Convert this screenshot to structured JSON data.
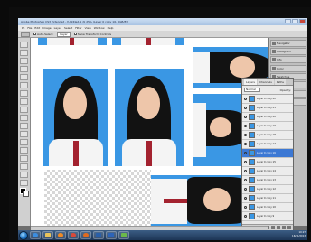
{
  "window": {
    "title": "Adobe Photoshop CS3 Extended - [Untitled-1 @ 25% (Layer 0 copy 16, RGB/8)]"
  },
  "menu": {
    "items": [
      "Ps",
      "File",
      "Edit",
      "Image",
      "Layer",
      "Select",
      "Filter",
      "View",
      "Window",
      "Help"
    ]
  },
  "options": {
    "auto_select": "Auto-Select:",
    "layer": "Layer",
    "show_transform": "Show Transform Controls"
  },
  "panels": {
    "items": [
      "Navigator",
      "Histogram",
      "Info",
      "Color",
      "Swatches",
      "Styles",
      "History",
      "Actions"
    ]
  },
  "layers": {
    "tabs": [
      "Layers",
      "Channels",
      "Paths"
    ],
    "blend_mode": "Normal",
    "opacity_label": "Opacity:",
    "rows": [
      "Layer 0 copy 22",
      "Layer 0 copy 21",
      "Layer 0 copy 20",
      "Layer 0 copy 19",
      "Layer 0 copy 18",
      "Layer 0 copy 17",
      "Layer 0 copy 16",
      "Layer 0 copy 15",
      "Layer 0 copy 14",
      "Layer 0 copy 13",
      "Layer 0 copy 12",
      "Layer 0 copy 11",
      "Layer 0 copy 10",
      "Layer 0 copy 9"
    ],
    "selected_index": 6
  },
  "tray": {
    "time": "10:27",
    "date": "16/11/2013"
  },
  "colors": {
    "photo_background": "#3a97e4",
    "tie": "#a3222f",
    "taskbar": "#1d3556"
  }
}
